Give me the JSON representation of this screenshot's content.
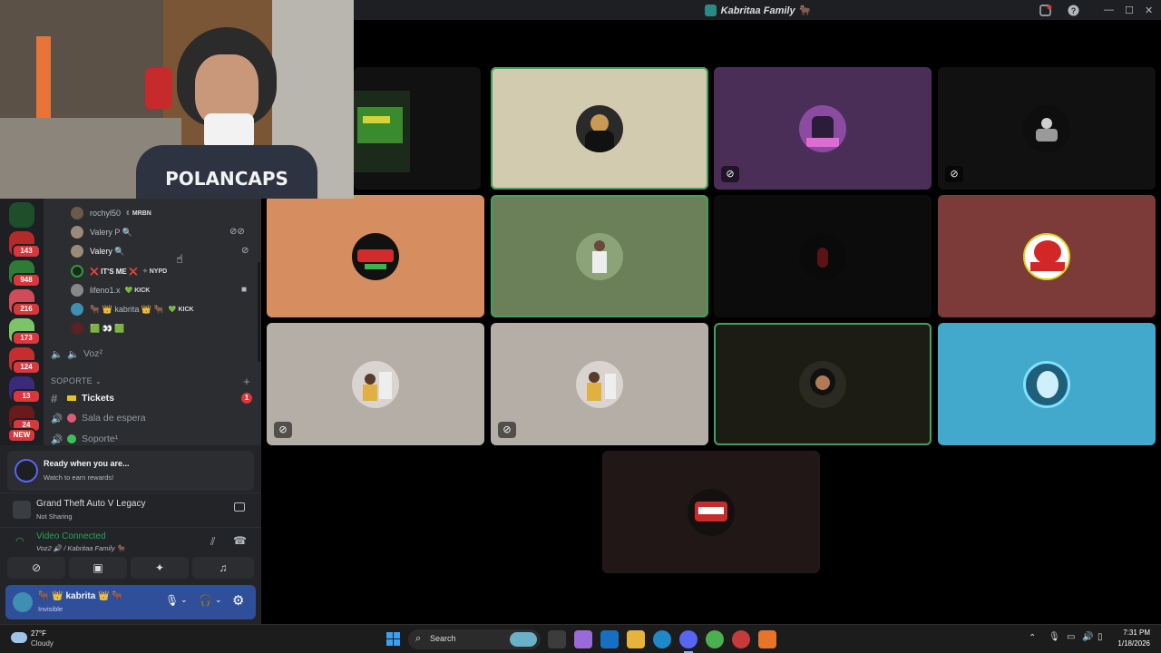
{
  "window": {
    "title": "Kabritaa Family 🐂",
    "controls": {
      "minimize": "—",
      "maximize": "☐",
      "close": "✕"
    }
  },
  "webcam": {
    "shirt_text": "POLANCAPS"
  },
  "server_rail": {
    "badges": [
      "143",
      "948",
      "216",
      "173",
      "124",
      "13",
      "24",
      "NEW"
    ]
  },
  "voice_members": [
    {
      "name": "rochyl50",
      "tag": "✌ MRBN"
    },
    {
      "name": "Valery P 🔍",
      "tag": ""
    },
    {
      "name": "Valery 🔍",
      "tag": ""
    },
    {
      "name": "❌ IT'S ME ❌",
      "tag": "✧ NYPD"
    },
    {
      "name": "lifeno1.x",
      "tag": "💚 KICK"
    },
    {
      "name": "🐂 👑 kabrita 👑 🐂",
      "tag": "💚 KICK"
    },
    {
      "name": "🟩 👀 🟩",
      "tag": ""
    }
  ],
  "channels": {
    "voice_channel": "Voz²",
    "category": "SOPORTE",
    "items": [
      {
        "prefix": "#",
        "label": "Tickets",
        "badge": "1"
      },
      {
        "prefix": "🔊",
        "label": "Sala de espera",
        "badge": ""
      },
      {
        "prefix": "🔊",
        "label": "Soporte¹",
        "badge": ""
      }
    ]
  },
  "panel": {
    "quest_title": "Ready when you are...",
    "quest_sub": "Watch to earn rewards!",
    "activity_title": "Grand Theft Auto V Legacy",
    "activity_sub": "Not Sharing",
    "voice_status": "Video Connected",
    "voice_location": "Voz2 🔊 / Kabritaa Family 🐂",
    "user_name": "🐂 👑 kabrita 👑 🐂",
    "user_status": "Invisible"
  },
  "taskbar": {
    "temp": "27°F",
    "weather": "Cloudy",
    "search_placeholder": "Search",
    "time": "7:31 PM",
    "date": "1/18/2026"
  },
  "colors": {
    "tile_cream": "#d3cbaf",
    "tile_purple": "#4a2e58",
    "tile_orange": "#d68e60",
    "tile_green": "#6b7f58",
    "tile_maroon": "#7c3a39",
    "tile_gray": "#b5aea7",
    "tile_blue": "#42a9cc",
    "speaking_ring": "#43a25a",
    "discord_blurple": "#5865f2"
  }
}
